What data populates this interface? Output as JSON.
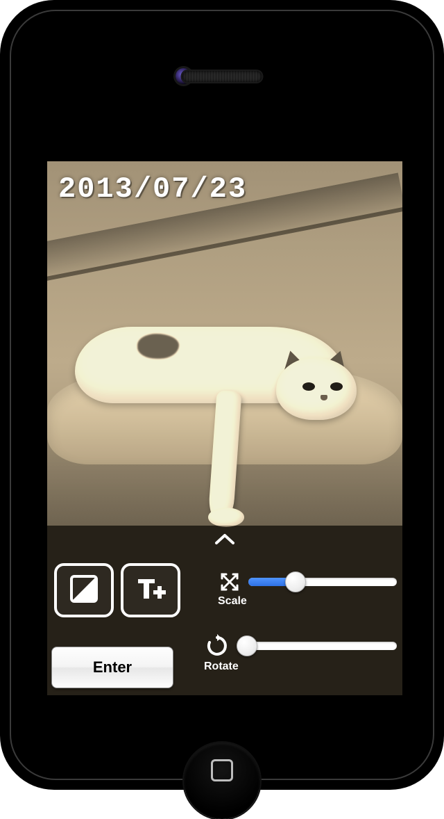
{
  "overlay": {
    "date_text": "2013/07/23"
  },
  "controls": {
    "collapse_icon": "chevron-up",
    "tools": {
      "filter_icon": "filter-contrast-icon",
      "text_icon": "text-add-icon"
    },
    "enter_label": "Enter",
    "sliders": {
      "scale": {
        "label": "Scale",
        "icon": "expand-arrows-icon",
        "value_pct": 32
      },
      "rotate": {
        "label": "Rotate",
        "icon": "rotate-cw-icon",
        "value_pct": 6
      }
    }
  }
}
